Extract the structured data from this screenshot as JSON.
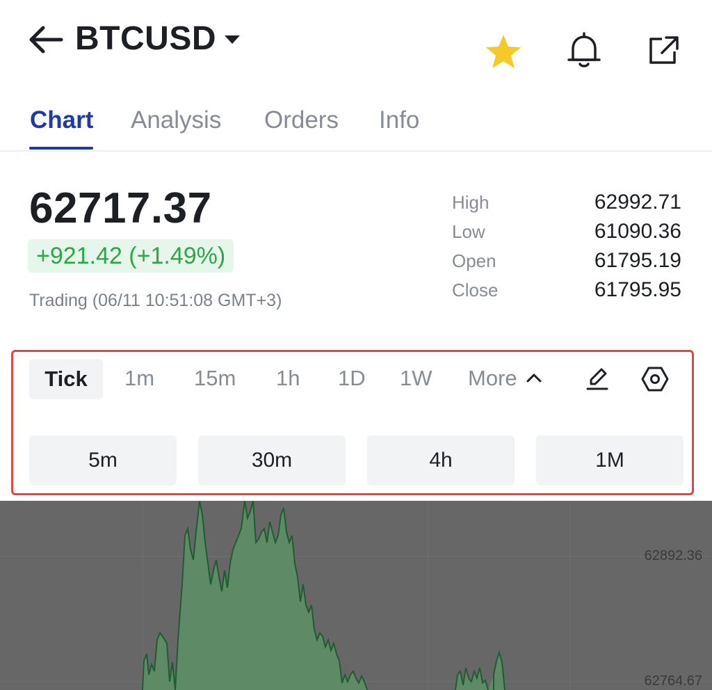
{
  "header": {
    "title": "BTCUSD",
    "icons": [
      "arrow-left-icon",
      "caret-down-icon",
      "star-icon",
      "bell-icon",
      "external-link-icon"
    ],
    "star_color": "#f7c928"
  },
  "tabs": [
    {
      "label": "Chart",
      "active": true
    },
    {
      "label": "Analysis",
      "active": false
    },
    {
      "label": "Orders",
      "active": false
    },
    {
      "label": "Info",
      "active": false
    }
  ],
  "quote": {
    "price": "62717.37",
    "change": "+921.42 (+1.49%)",
    "status": "Trading (06/11 10:51:08 GMT+3)",
    "stats": [
      {
        "label": "High",
        "value": "62992.71"
      },
      {
        "label": "Low",
        "value": "61090.36"
      },
      {
        "label": "Open",
        "value": "61795.19"
      },
      {
        "label": "Close",
        "value": "61795.95"
      }
    ]
  },
  "intervals": {
    "primary": [
      "Tick",
      "1m",
      "15m",
      "1h",
      "1D",
      "1W",
      "More"
    ],
    "selected": "Tick",
    "expanded": [
      "5m",
      "30m",
      "4h",
      "1M"
    ],
    "highlight_color": "#e54444"
  },
  "chart": {
    "y_labels": [
      "62892.36",
      "62764.67"
    ],
    "line_color": "#1f5c32",
    "fill_color": "#5f8a66"
  },
  "colors": {
    "accent": "#1c3aa8",
    "positive": "#2fa54a",
    "positive_bg": "#e6f6ea"
  }
}
